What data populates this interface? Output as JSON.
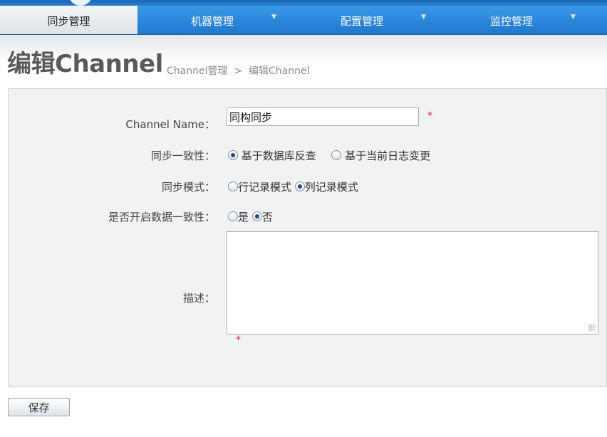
{
  "nav": {
    "tabs": [
      {
        "label": "同步管理",
        "active": true
      },
      {
        "label": "机器管理",
        "active": false
      },
      {
        "label": "配置管理",
        "active": false
      },
      {
        "label": "监控管理",
        "active": false
      }
    ],
    "caret_icon": "dropdown-caret-icon"
  },
  "page": {
    "title": "编辑Channel",
    "breadcrumb": [
      "Channel管理",
      ">",
      "编辑Channel"
    ]
  },
  "form": {
    "channel_name": {
      "label": "Channel Name：",
      "value": "同构同步",
      "required_mark": "*"
    },
    "consistency": {
      "label": "同步一致性：",
      "options": [
        {
          "label": "基于数据库反查",
          "selected": true
        },
        {
          "label": "基于当前日志变更",
          "selected": false
        }
      ]
    },
    "sync_mode": {
      "label": "同步模式：",
      "options": [
        {
          "label": "行记录模式",
          "selected": false
        },
        {
          "label": "列记录模式",
          "selected": true
        }
      ]
    },
    "data_consistency": {
      "label": "是否开启数据一致性：",
      "options": [
        {
          "label": "是",
          "selected": false
        },
        {
          "label": "否",
          "selected": true
        }
      ]
    },
    "description": {
      "label": "描述：",
      "value": "",
      "required_mark": "*"
    }
  },
  "actions": {
    "save_label": "保存"
  },
  "colors": {
    "nav_blue": "#2b86d9",
    "required": "#e02020",
    "panel_bg": "#f1f2f3"
  }
}
